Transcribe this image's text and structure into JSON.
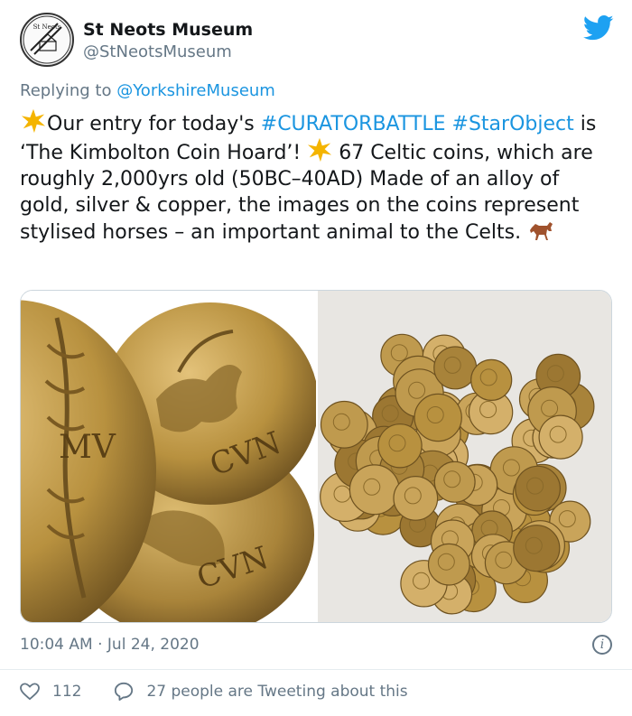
{
  "account": {
    "name": "St Neots Museum",
    "handle": "@StNeotsMuseum",
    "avatar_text": "St Neots"
  },
  "reply": {
    "prefix": "Replying to ",
    "mention": "@YorkshireMuseum"
  },
  "tweet": {
    "part1": "Our entry for today's ",
    "tag1": "#CURATORBATTLE",
    "space": " ",
    "tag2": "#StarObject",
    "part2": " is ‘The Kimbolton Coin Hoard’! ",
    "part3": " 67 Celtic coins, which are roughly 2,000yrs old (50BC–40AD) Made of an alloy of gold, silver & copper, the images on the coins represent stylised horses – an important animal to the Celts. "
  },
  "coin_inscriptions": {
    "left_coin": "MV",
    "middle_coin": "CVN",
    "bottom_coin": "CVN"
  },
  "timestamp": "10:04 AM · Jul 24, 2020",
  "stats": {
    "likes": "112",
    "tweeting": "27 people are Tweeting about this"
  },
  "colors": {
    "link": "#1b95e0",
    "secondary": "#657786",
    "twitter_blue": "#1da1f2",
    "gold": "#b8913f"
  }
}
